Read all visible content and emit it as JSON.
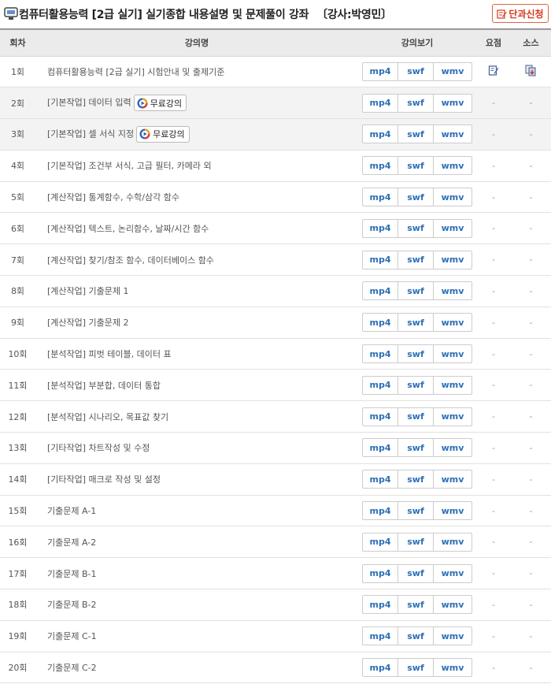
{
  "header": {
    "title": "컴퓨터활용능력 [2급 실기] 실기종합 내용설명 및 문제풀이 강좌",
    "teacher": "〔강사:박영민〕",
    "apply_label": "단과신청"
  },
  "columns": [
    "회차",
    "강의명",
    "강의보기",
    "요점",
    "소스"
  ],
  "formats": [
    "mp4",
    "swf",
    "wmv"
  ],
  "free_label": "무료강의",
  "dash": "-",
  "rows": [
    {
      "num": "1회",
      "title": "컴퓨터활용능력 [2급 실기] 시험안내 및 출제기준"
    },
    {
      "num": "2회",
      "title": "[기본작업] 데이터 입력"
    },
    {
      "num": "3회",
      "title": "[기본작업] 셀 서식 지정"
    },
    {
      "num": "4회",
      "title": "[기본작업] 조건부 서식, 고급 필터, 카메라 외"
    },
    {
      "num": "5회",
      "title": "[계산작업] 통계함수, 수학/삼각 함수"
    },
    {
      "num": "6회",
      "title": "[계산작업] 텍스트, 논리함수, 날짜/시간 함수"
    },
    {
      "num": "7회",
      "title": "[계산작업] 찾기/참조 함수, 데이터베이스 함수"
    },
    {
      "num": "8회",
      "title": "[계산작업] 기출문제 1"
    },
    {
      "num": "9회",
      "title": "[계산작업] 기출문제 2"
    },
    {
      "num": "10회",
      "title": "[분석작업] 피벗 테이블, 데이터 표"
    },
    {
      "num": "11회",
      "title": "[분석작업] 부분합, 데이터 통합"
    },
    {
      "num": "12회",
      "title": "[분석작업] 시나리오, 목표값 찾기"
    },
    {
      "num": "13회",
      "title": "[기타작업] 차트작성 및 수정"
    },
    {
      "num": "14회",
      "title": "[기타작업] 매크로 작성 및 설정"
    },
    {
      "num": "15회",
      "title": "기출문제 A-1"
    },
    {
      "num": "16회",
      "title": "기출문제 A-2"
    },
    {
      "num": "17회",
      "title": "기출문제 B-1"
    },
    {
      "num": "18회",
      "title": "기출문제 B-2"
    },
    {
      "num": "19회",
      "title": "기출문제 C-1"
    },
    {
      "num": "20회",
      "title": "기출문제 C-2"
    }
  ]
}
